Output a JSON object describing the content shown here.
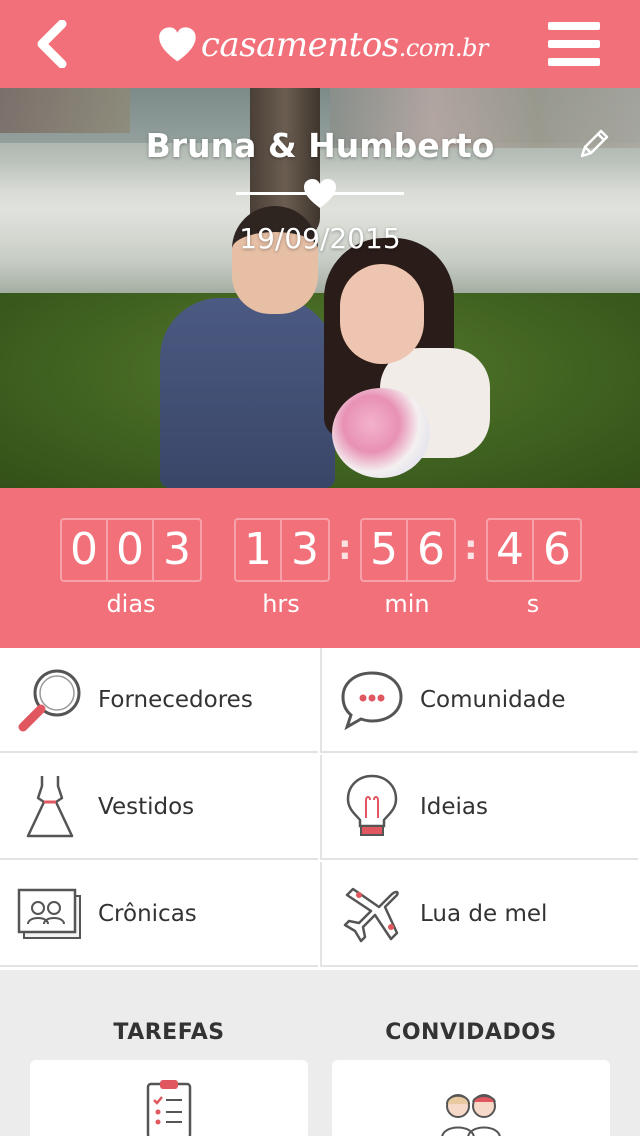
{
  "header": {
    "back_icon": "chevron-left-icon",
    "logo_main": "casamentos",
    "logo_suffix": ".com.br",
    "menu_icon": "hamburger-icon"
  },
  "hero": {
    "couple_name": "Bruna & Humberto",
    "wedding_date": "19/09/2015",
    "edit_icon": "pencil-icon"
  },
  "countdown": {
    "days_digits": [
      "0",
      "0",
      "3"
    ],
    "hours_digits": [
      "1",
      "3"
    ],
    "minutes_digits": [
      "5",
      "6"
    ],
    "seconds_digits": [
      "4",
      "6"
    ],
    "separator": ":",
    "days_label": "dias",
    "hours_label": "hrs",
    "minutes_label": "min",
    "seconds_label": "s"
  },
  "menu": [
    {
      "label": "Fornecedores",
      "icon": "magnifier-icon"
    },
    {
      "label": "Comunidade",
      "icon": "chat-bubble-icon"
    },
    {
      "label": "Vestidos",
      "icon": "dress-icon"
    },
    {
      "label": "Ideias",
      "icon": "lightbulb-icon"
    },
    {
      "label": "Crônicas",
      "icon": "photo-album-icon"
    },
    {
      "label": "Lua de mel",
      "icon": "airplane-icon"
    }
  ],
  "sections": {
    "tasks_title": "TAREFAS",
    "guests_title": "CONVIDADOS",
    "tasks_icon": "checklist-icon",
    "guests_icon": "guests-icon"
  },
  "colors": {
    "brand": "#f2707a",
    "text": "#333333",
    "background": "#ececec"
  }
}
